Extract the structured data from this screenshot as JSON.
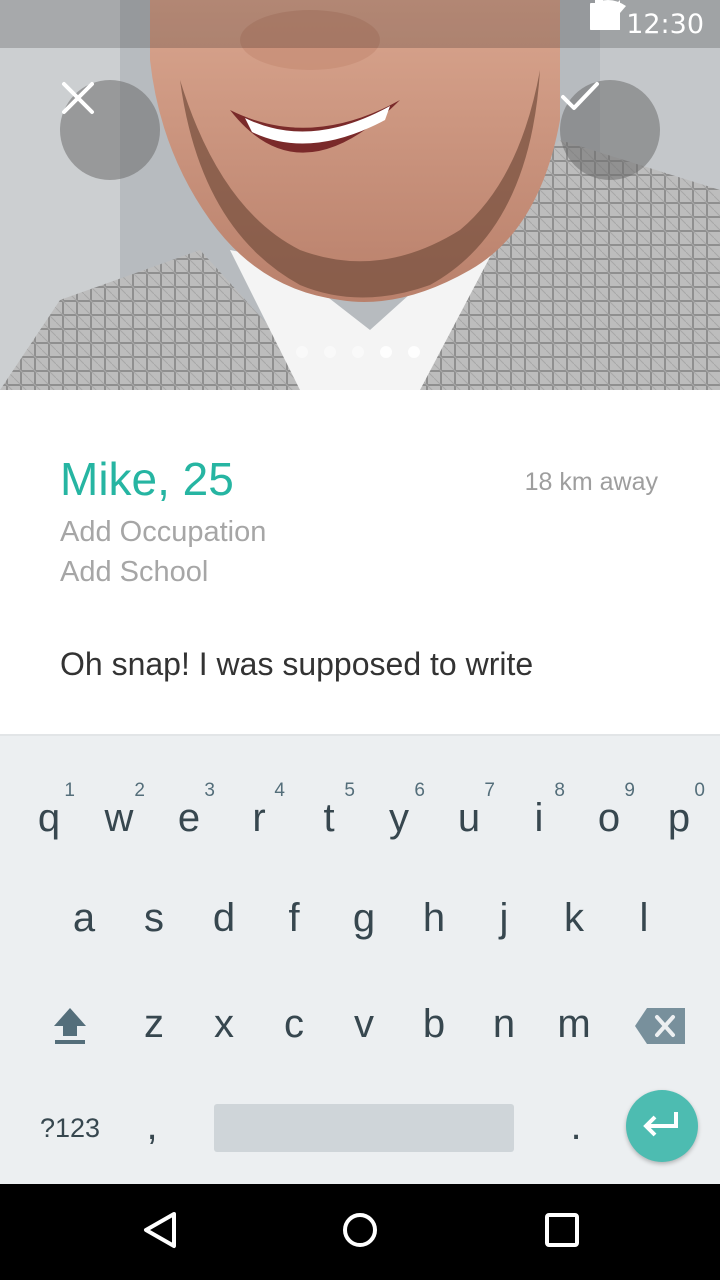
{
  "status_bar": {
    "time": "12:30",
    "icons": [
      "wifi-icon",
      "signal-icon",
      "battery-icon"
    ]
  },
  "photo": {
    "page_count": 5,
    "active_page": 1,
    "dismiss_icon": "close-icon",
    "accept_icon": "check-icon"
  },
  "profile": {
    "name_age": "Mike, 25",
    "distance": "18 km away",
    "occupation_placeholder": "Add Occupation",
    "school_placeholder": "Add School",
    "bio": "Oh snap! I was supposed to write"
  },
  "keyboard": {
    "row1": [
      {
        "key": "q",
        "hint": "1"
      },
      {
        "key": "w",
        "hint": "2"
      },
      {
        "key": "e",
        "hint": "3"
      },
      {
        "key": "r",
        "hint": "4"
      },
      {
        "key": "t",
        "hint": "5"
      },
      {
        "key": "y",
        "hint": "6"
      },
      {
        "key": "u",
        "hint": "7"
      },
      {
        "key": "i",
        "hint": "8"
      },
      {
        "key": "o",
        "hint": "9"
      },
      {
        "key": "p",
        "hint": "0"
      }
    ],
    "row2": [
      "a",
      "s",
      "d",
      "f",
      "g",
      "h",
      "j",
      "k",
      "l"
    ],
    "row3": [
      "z",
      "x",
      "c",
      "v",
      "b",
      "n",
      "m"
    ],
    "symbols_label": "?123",
    "comma_label": ",",
    "period_label": ".",
    "enter_color": "#4dbcb1"
  },
  "colors": {
    "accent": "#26b5a2",
    "secondary_text": "#a6a6a6",
    "keyboard_bg": "#eceff1"
  },
  "nav": {
    "icons": [
      "back-icon",
      "home-icon",
      "recents-icon"
    ]
  }
}
